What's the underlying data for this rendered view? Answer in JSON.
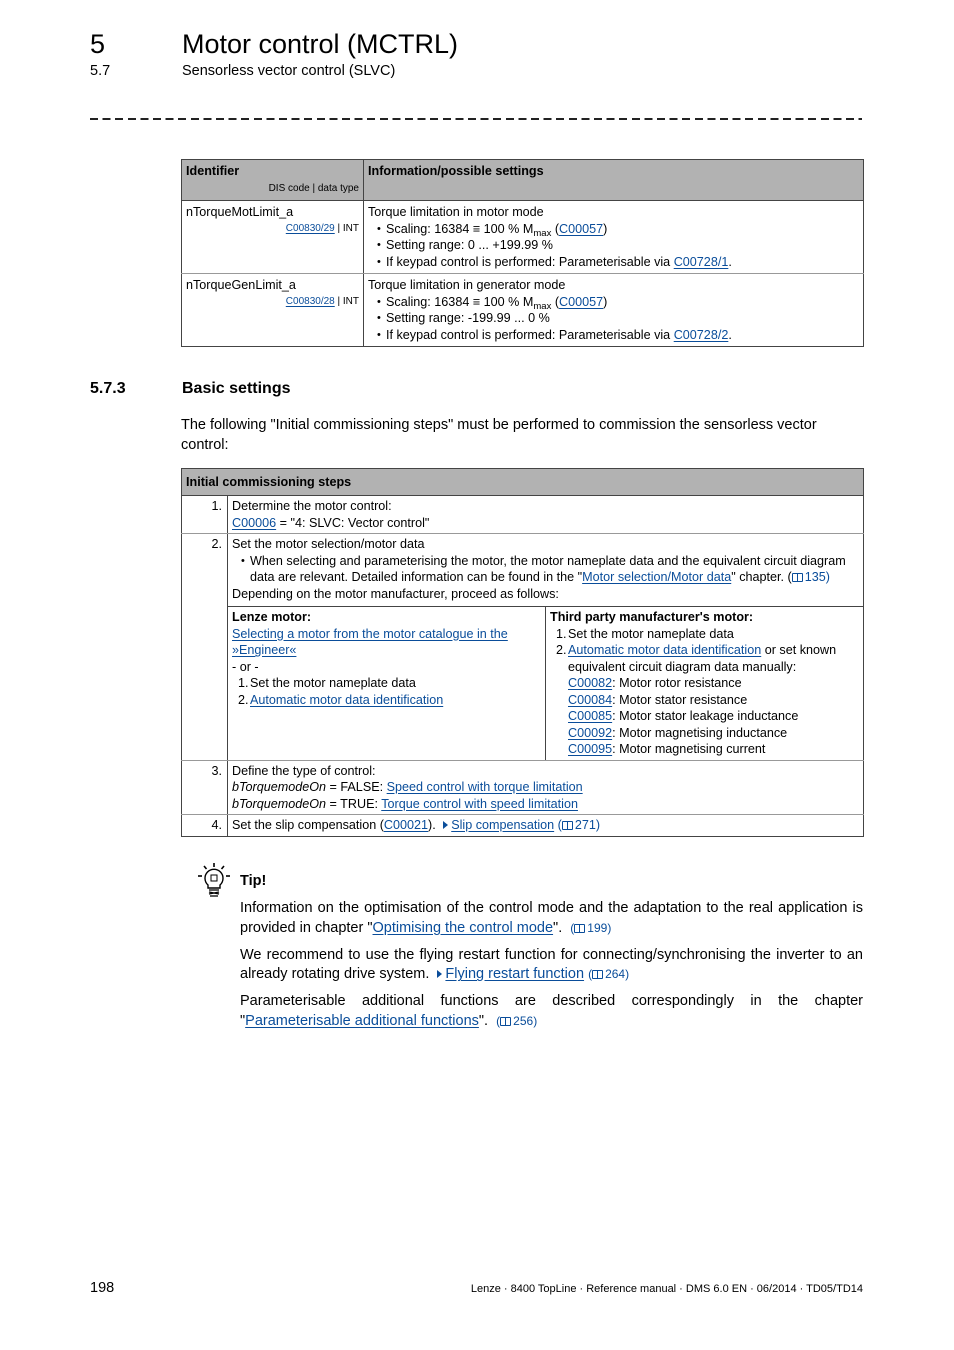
{
  "header": {
    "chapter_number": "5",
    "chapter_title": "Motor control (MCTRL)",
    "section_number": "5.7",
    "section_title": "Sensorless vector control (SLVC)"
  },
  "signal_table": {
    "col1_header": "Identifier",
    "col1_subheader": "DIS code | data type",
    "col2_header": "Information/possible settings",
    "rows": [
      {
        "identifier": "nTorqueMotLimit_a",
        "dis_code": "C00830/29",
        "data_type": " | INT",
        "title": "Torque limitation in motor mode",
        "scaling_prefix": "Scaling: 16384 ≡ 100 % M",
        "scaling_sub": "max",
        "scaling_link": "C00057",
        "range": "Setting range: 0 ... +199.99 %",
        "keypad_prefix": "If keypad control is performed: Parameterisable via ",
        "keypad_link": "C00728/1"
      },
      {
        "identifier": "nTorqueGenLimit_a",
        "dis_code": "C00830/28",
        "data_type": " | INT",
        "title": "Torque limitation in generator mode",
        "scaling_prefix": "Scaling: 16384 ≡ 100 % M",
        "scaling_sub": "max",
        "scaling_link": "C00057",
        "range": "Setting range: -199.99 ... 0 %",
        "keypad_prefix": "If keypad control is performed: Parameterisable via ",
        "keypad_link": "C00728/2"
      }
    ]
  },
  "basic_settings": {
    "number": "5.7.3",
    "title": "Basic settings",
    "intro": "The following \"Initial commissioning steps\" must be performed to commission the sensorless vector control:"
  },
  "steps_table": {
    "header": "Initial commissioning steps",
    "step1": {
      "num": "1.",
      "text": "Determine the motor control:",
      "link": "C00006",
      "value": " = \"4: SLVC: Vector control\""
    },
    "step2": {
      "num": "2.",
      "text": "Set the motor selection/motor data",
      "bullet_prefix": "When selecting and parameterising the motor, the motor nameplate data and the equivalent circuit diagram data are relevant. Detailed information can be found in the \"",
      "bullet_link": "Motor selection/Motor data",
      "bullet_suffix": "\" chapter. (",
      "bullet_page": "135",
      "proceed": "Depending on the motor manufacturer, proceed as follows:",
      "lenze": {
        "title": "Lenze motor:",
        "link": "Selecting a motor from the motor catalogue in the »Engineer«",
        "or": "- or -",
        "item1_num": "1.",
        "item1": "Set the motor nameplate data",
        "item2_num": "2.",
        "item2_link": "Automatic motor data identification"
      },
      "third_party": {
        "title": "Third party manufacturer's motor:",
        "item1_num": "1.",
        "item1": "Set the motor nameplate data",
        "item2_num": "2.",
        "item2_link": "Automatic motor data identification",
        "item2_suffix": " or set known equivalent circuit diagram data manually:",
        "codes": [
          {
            "code": "C00082",
            "desc": ": Motor rotor resistance"
          },
          {
            "code": "C00084",
            "desc": ": Motor stator resistance"
          },
          {
            "code": "C00085",
            "desc": ": Motor stator leakage inductance"
          },
          {
            "code": "C00092",
            "desc": ": Motor magnetising inductance"
          },
          {
            "code": "C00095",
            "desc": ": Motor magnetising current"
          }
        ]
      }
    },
    "step3": {
      "num": "3.",
      "text": "Define the type of control:",
      "var": "bTorquemodeOn",
      "false_value": " = FALSE: ",
      "false_link": "Speed control with torque limitation",
      "true_value": " = TRUE: ",
      "true_link": "Torque control with speed limitation"
    },
    "step4": {
      "num": "4.",
      "prefix": "Set the slip compensation (",
      "link": "C00021",
      "suffix": ").",
      "ref_link": "Slip compensation",
      "ref_page": "271"
    }
  },
  "tip": {
    "label": "Tip!",
    "p1_prefix": "Information on the optimisation of the control mode and the adaptation to the real application is provided in chapter \"",
    "p1_link": "Optimising the control mode",
    "p1_suffix": "\".",
    "p1_page": "199",
    "p2_text": "We recommend to use the flying restart function for connecting/synchronising the inverter to an already rotating drive system.",
    "p2_link": "Flying restart function",
    "p2_page": "264",
    "p3_prefix": "Parameterisable additional functions are described correspondingly in the chapter \"",
    "p3_link": "Parameterisable additional functions",
    "p3_suffix": "\".",
    "p3_page": "256"
  },
  "footer": {
    "page_number": "198",
    "doc_info": "Lenze · 8400 TopLine · Reference manual · DMS 6.0 EN · 06/2014 · TD05/TD14"
  }
}
